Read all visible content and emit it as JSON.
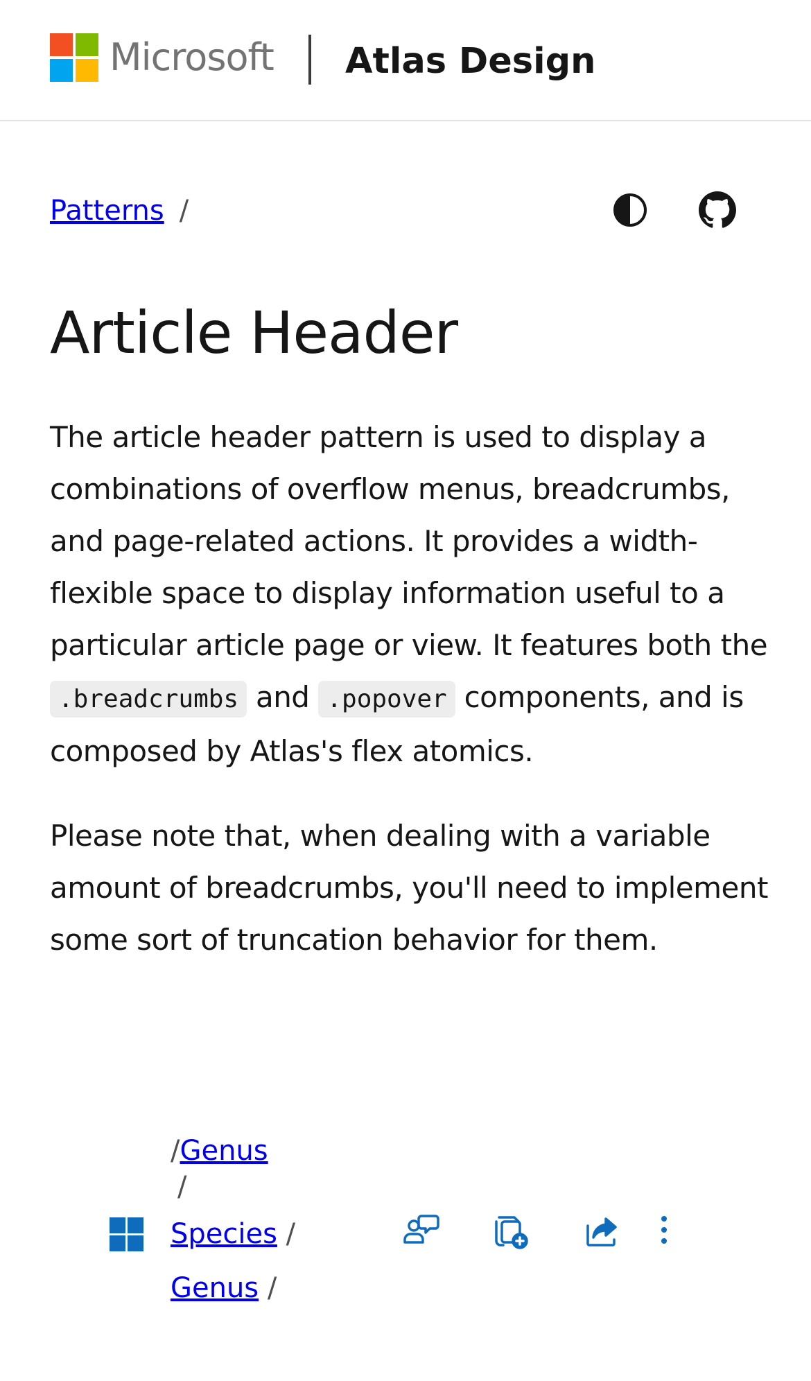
{
  "header": {
    "brand": "Microsoft",
    "site_title": "Atlas Design",
    "brand_colors": [
      "#f25022",
      "#7fba00",
      "#00a4ef",
      "#ffb900"
    ]
  },
  "breadcrumb": {
    "items": [
      {
        "label": "Patterns"
      }
    ],
    "separator": "/"
  },
  "toolbar": {
    "theme_icon": "contrast-icon",
    "github_icon": "github-icon"
  },
  "page": {
    "title": "Article Header",
    "p1_a": "The article header pattern is used to display a combinations of overflow menus, breadcrumbs, and page-related actions. It provides a width-flexible space to display information useful to a particular article page or view. It features both the",
    "code1": ".breadcrumbs",
    "p1_and": "and",
    "code2": ".popover",
    "p1_b": "components, and is composed by Atlas's flex atomics.",
    "p2": "Please note that, when dealing with a variable amount of breadcrumbs, you'll need to implement some sort of truncation behavior for them."
  },
  "demo": {
    "logo_icon": "windows-logo-icon",
    "accent": "#0f6cbd",
    "crumbs": {
      "sep": "/",
      "item1": "Genus",
      "item2": "Species",
      "item3": "Genus"
    },
    "actions": [
      {
        "icon": "feedback-icon"
      },
      {
        "icon": "add-to-collection-icon"
      },
      {
        "icon": "share-icon"
      },
      {
        "icon": "more-options-icon"
      }
    ]
  }
}
